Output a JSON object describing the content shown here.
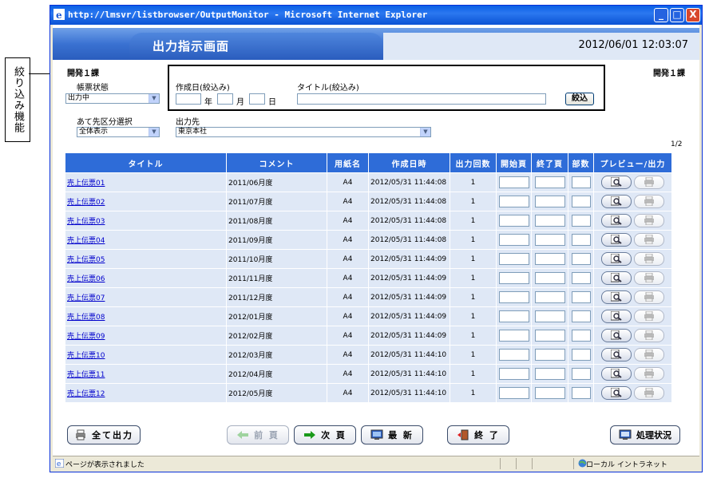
{
  "annotation": {
    "label": "絞り込み機能"
  },
  "window": {
    "title": "http://lmsvr/listbrowser/OutputMonitor - Microsoft Internet Explorer",
    "minimize": "_",
    "maximize": "□",
    "close": "X"
  },
  "header": {
    "title": "出力指示画面",
    "datetime": "2012/06/01  12:03:07"
  },
  "dept_left": "開発１課",
  "dept_right": "開発１課",
  "filters": {
    "status_label": "帳票状態",
    "status_value": "出力中",
    "created_label": "作成日(絞込み)",
    "year": "年",
    "month": "月",
    "day": "日",
    "title_label": "タイトル(絞込み)",
    "filter_button": "絞込",
    "dest_type_label": "あて先区分選択",
    "dest_type_value": "全体表示",
    "dest_label": "出力先",
    "dest_value": "東京本社"
  },
  "page_indicator": "1/2",
  "table": {
    "headers": [
      "タイトル",
      "コメント",
      "用紙名",
      "作成日時",
      "出力回数",
      "開始頁",
      "終了頁",
      "部数",
      "プレビュー/出力"
    ],
    "rows": [
      {
        "title": "売上伝票01",
        "comment": "2011/06月度",
        "paper": "A4",
        "created": "2012/05/31 11:44:08",
        "count": "1"
      },
      {
        "title": "売上伝票02",
        "comment": "2011/07月度",
        "paper": "A4",
        "created": "2012/05/31 11:44:08",
        "count": "1"
      },
      {
        "title": "売上伝票03",
        "comment": "2011/08月度",
        "paper": "A4",
        "created": "2012/05/31 11:44:08",
        "count": "1"
      },
      {
        "title": "売上伝票04",
        "comment": "2011/09月度",
        "paper": "A4",
        "created": "2012/05/31 11:44:08",
        "count": "1"
      },
      {
        "title": "売上伝票05",
        "comment": "2011/10月度",
        "paper": "A4",
        "created": "2012/05/31 11:44:09",
        "count": "1"
      },
      {
        "title": "売上伝票06",
        "comment": "2011/11月度",
        "paper": "A4",
        "created": "2012/05/31 11:44:09",
        "count": "1"
      },
      {
        "title": "売上伝票07",
        "comment": "2011/12月度",
        "paper": "A4",
        "created": "2012/05/31 11:44:09",
        "count": "1"
      },
      {
        "title": "売上伝票08",
        "comment": "2012/01月度",
        "paper": "A4",
        "created": "2012/05/31 11:44:09",
        "count": "1"
      },
      {
        "title": "売上伝票09",
        "comment": "2012/02月度",
        "paper": "A4",
        "created": "2012/05/31 11:44:09",
        "count": "1"
      },
      {
        "title": "売上伝票10",
        "comment": "2012/03月度",
        "paper": "A4",
        "created": "2012/05/31 11:44:10",
        "count": "1"
      },
      {
        "title": "売上伝票11",
        "comment": "2012/04月度",
        "paper": "A4",
        "created": "2012/05/31 11:44:10",
        "count": "1"
      },
      {
        "title": "売上伝票12",
        "comment": "2012/05月度",
        "paper": "A4",
        "created": "2012/05/31 11:44:10",
        "count": "1"
      }
    ]
  },
  "buttons": {
    "print_all": "全て出力",
    "prev": "前 頁",
    "next": "次 頁",
    "refresh": "最 新",
    "exit": "終 了",
    "status": "処理状況"
  },
  "statusbar": {
    "left": "ページが表示されました",
    "right": "ローカル イントラネット"
  }
}
